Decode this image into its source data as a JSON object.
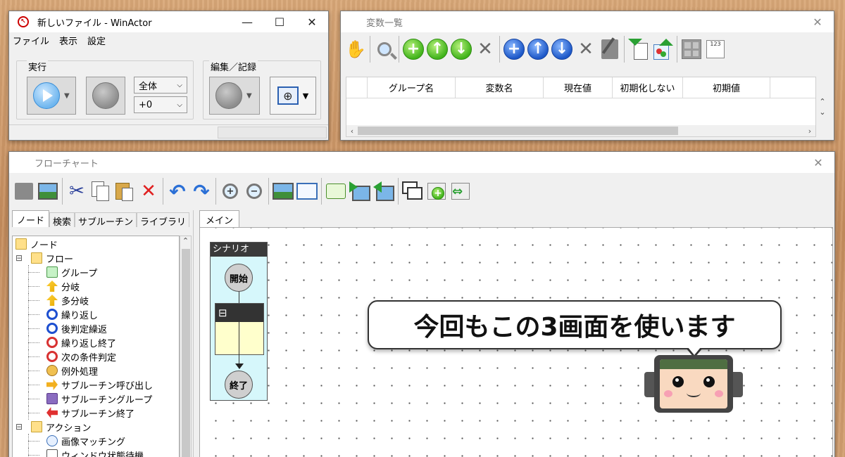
{
  "winactor": {
    "title": "新しいファイル - WinActor",
    "menu": [
      "ファイル",
      "表示",
      "設定"
    ],
    "run_group_label": "実行",
    "edit_group_label": "編集／記録",
    "scope_select": "全体",
    "speed_select": "+0",
    "minimize": "—",
    "maximize": "☐",
    "close": "✕"
  },
  "variables": {
    "title": "変数一覧",
    "close": "✕",
    "columns": [
      "グループ名",
      "変数名",
      "現在値",
      "初期化しない",
      "初期値"
    ],
    "toolbar_icons": [
      "hand-icon",
      "magnifier-icon",
      "add-green-icon",
      "up-green-icon",
      "down-green-icon",
      "delete-gray-icon",
      "add-blue-icon",
      "up-blue-icon",
      "down-blue-icon",
      "delete-gray-icon",
      "edit-icon",
      "import-icon",
      "export-icon",
      "grid-icon",
      "counter-icon"
    ]
  },
  "flowchart": {
    "title": "フローチャート",
    "close": "✕",
    "side_tabs": [
      "ノード",
      "検索",
      "サブルーチン",
      "ライブラリ"
    ],
    "main_tab": "メイン",
    "tree": [
      {
        "label": "ノード",
        "level": 0,
        "icon": "folder",
        "expander": ""
      },
      {
        "label": "フロー",
        "level": 1,
        "icon": "folder",
        "expander": "⊟"
      },
      {
        "label": "グループ",
        "level": 2,
        "icon": "group"
      },
      {
        "label": "分岐",
        "level": 2,
        "icon": "branch"
      },
      {
        "label": "多分岐",
        "level": 2,
        "icon": "branch"
      },
      {
        "label": "繰り返し",
        "level": 2,
        "icon": "loop"
      },
      {
        "label": "後判定繰返",
        "level": 2,
        "icon": "loop"
      },
      {
        "label": "繰り返し終了",
        "level": 2,
        "icon": "loop-end"
      },
      {
        "label": "次の条件判定",
        "level": 2,
        "icon": "loop-end"
      },
      {
        "label": "例外処理",
        "level": 2,
        "icon": "exception"
      },
      {
        "label": "サブルーチン呼び出し",
        "level": 2,
        "icon": "sub-call"
      },
      {
        "label": "サブルーチングループ",
        "level": 2,
        "icon": "sub-group"
      },
      {
        "label": "サブルーチン終了",
        "level": 2,
        "icon": "sub-end"
      },
      {
        "label": "アクション",
        "level": 1,
        "icon": "folder",
        "expander": "⊟"
      },
      {
        "label": "画像マッチング",
        "level": 2,
        "icon": "image-match"
      },
      {
        "label": "ウィンドウ状態待機",
        "level": 2,
        "icon": "window"
      }
    ],
    "scenario": {
      "title": "シナリオ",
      "start": "開始",
      "end": "終了",
      "group_toggle": "⊟"
    }
  },
  "callout": {
    "text": "今回もこの3画面を使います"
  },
  "colors": {
    "accent_blue": "#1d58c8",
    "accent_green": "#42b41c",
    "scenario_bg": "#d6f7fb",
    "group_body": "#ffffcc"
  }
}
